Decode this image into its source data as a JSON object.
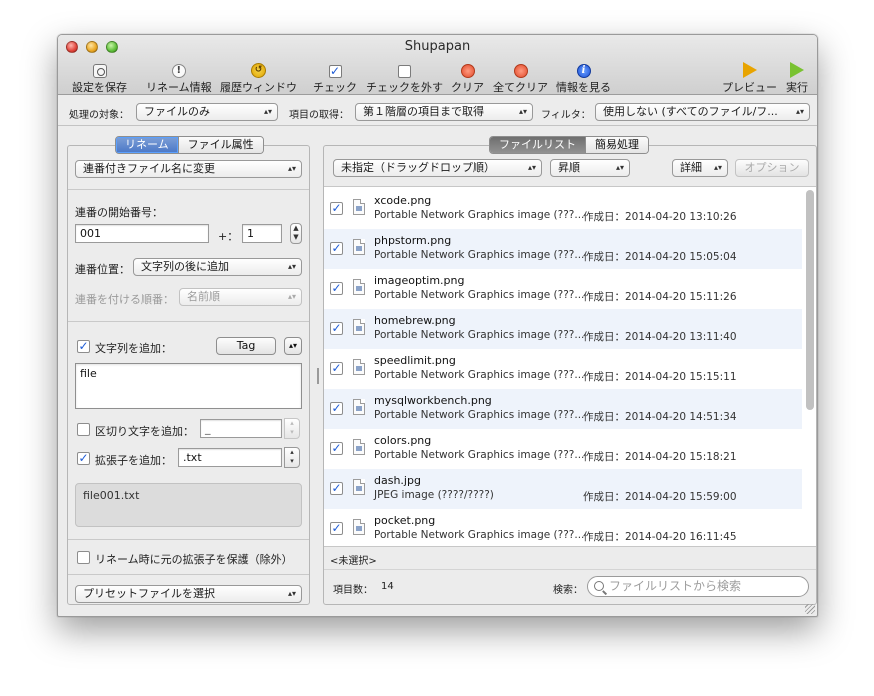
{
  "window": {
    "title": "Shupapan"
  },
  "toolbar": {
    "left_items": [
      {
        "label": "設定を保存",
        "icon": "gear-icon"
      },
      {
        "label": "リネーム情報",
        "icon": "info-icon"
      },
      {
        "label": "履歴ウィンドウ",
        "icon": "history-icon"
      },
      {
        "label": "チェック",
        "icon": "check-icon"
      },
      {
        "label": "チェックを外す",
        "icon": "uncheck-icon"
      },
      {
        "label": "クリア",
        "icon": "clear-icon"
      },
      {
        "label": "全てクリア",
        "icon": "clear-all-icon"
      },
      {
        "label": "情報を見る",
        "icon": "info-blue-icon"
      }
    ],
    "right_items": [
      {
        "label": "プレビュー",
        "icon": "preview-icon"
      },
      {
        "label": "実行",
        "icon": "run-icon"
      }
    ]
  },
  "options_bar": {
    "target_label": "処理の対象：",
    "target_value": "ファイルのみ",
    "fetch_label": "項目の取得：",
    "fetch_value": "第１階層の項目まで取得",
    "filter_label": "フィルタ：",
    "filter_value": "使用しない (すべてのファイル/フ..."
  },
  "left_panel": {
    "tabs": [
      {
        "label": "リネーム",
        "active": true
      },
      {
        "label": "ファイル属性",
        "active": false
      }
    ],
    "mode_value": "連番付きファイル名に変更",
    "start_number_label": "連番の開始番号：",
    "start_number_value": "001",
    "step_label": "+：",
    "step_value": "1",
    "position_label": "連番位置：",
    "position_value": "文字列の後に追加",
    "order_label": "連番を付ける順番：",
    "order_value": "名前順",
    "add_string_label": "文字列を追加：",
    "add_string_checked": true,
    "tag_button_label": "Tag",
    "add_string_value": "file",
    "separator_label": "区切り文字を追加：",
    "separator_checked": false,
    "separator_value": "_",
    "extension_label": "拡張子を追加：",
    "extension_checked": true,
    "extension_value": ".txt",
    "preview_text": "file001.txt",
    "protect_ext_label": "リネーム時に元の拡張子を保護（除外）",
    "protect_ext_checked": false,
    "preset_value": "プリセットファイルを選択"
  },
  "right_panel": {
    "tabs": [
      {
        "label": "ファイルリスト",
        "active": true
      },
      {
        "label": "簡易処理",
        "active": false
      }
    ],
    "sort_value": "未指定（ドラッグドロップ順）",
    "order_value": "昇順",
    "detail_value": "詳細",
    "options_button_label": "オプション",
    "files": [
      {
        "name": "xcode.png",
        "kind": "Portable Network Graphics image (???...",
        "date": "作成日：2014-04-20 13:10:26",
        "checked": true
      },
      {
        "name": "phpstorm.png",
        "kind": "Portable Network Graphics image (???...",
        "date": "作成日：2014-04-20 15:05:04",
        "checked": true
      },
      {
        "name": "imageoptim.png",
        "kind": "Portable Network Graphics image (???...",
        "date": "作成日：2014-04-20 15:11:26",
        "checked": true
      },
      {
        "name": "homebrew.png",
        "kind": "Portable Network Graphics image (???...",
        "date": "作成日：2014-04-20 13:11:40",
        "checked": true
      },
      {
        "name": "speedlimit.png",
        "kind": "Portable Network Graphics image (???...",
        "date": "作成日：2014-04-20 15:15:11",
        "checked": true
      },
      {
        "name": "mysqlworkbench.png",
        "kind": "Portable Network Graphics image (???...",
        "date": "作成日：2014-04-20 14:51:34",
        "checked": true
      },
      {
        "name": "colors.png",
        "kind": "Portable Network Graphics image (???...",
        "date": "作成日：2014-04-20 15:18:21",
        "checked": true
      },
      {
        "name": "dash.jpg",
        "kind": "JPEG image (????/????)",
        "date": "作成日：2014-04-20 15:59:00",
        "checked": true
      },
      {
        "name": "pocket.png",
        "kind": "Portable Network Graphics image (???...",
        "date": "作成日：2014-04-20 16:11:45",
        "checked": true
      }
    ],
    "selection_text": "<未選択>",
    "count_label": "項目数：",
    "count_value": "14",
    "search_label": "検索：",
    "search_placeholder": "ファイルリストから検索"
  }
}
